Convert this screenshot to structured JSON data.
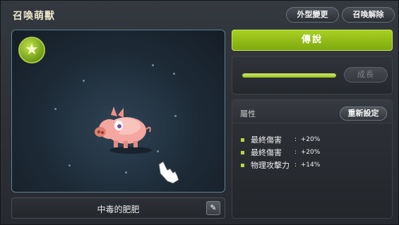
{
  "window": {
    "title": "召喚萌獸"
  },
  "header": {
    "appearance_label": "外型變更",
    "dismiss_label": "召喚解除"
  },
  "pet": {
    "name": "中毒的肥肥",
    "badge_icon": "star-icon"
  },
  "grade": {
    "label": "傳說",
    "color": "#98c321"
  },
  "growth": {
    "button_label": "成長",
    "progress": 1.0
  },
  "attributes": {
    "title": "屬性",
    "reset_label": "重新設定",
    "items": [
      {
        "label": "最終傷害",
        "value": "+20%"
      },
      {
        "label": "最終傷害",
        "value": "+20%"
      },
      {
        "label": "物理攻擊力",
        "value": "+14%"
      }
    ]
  }
}
